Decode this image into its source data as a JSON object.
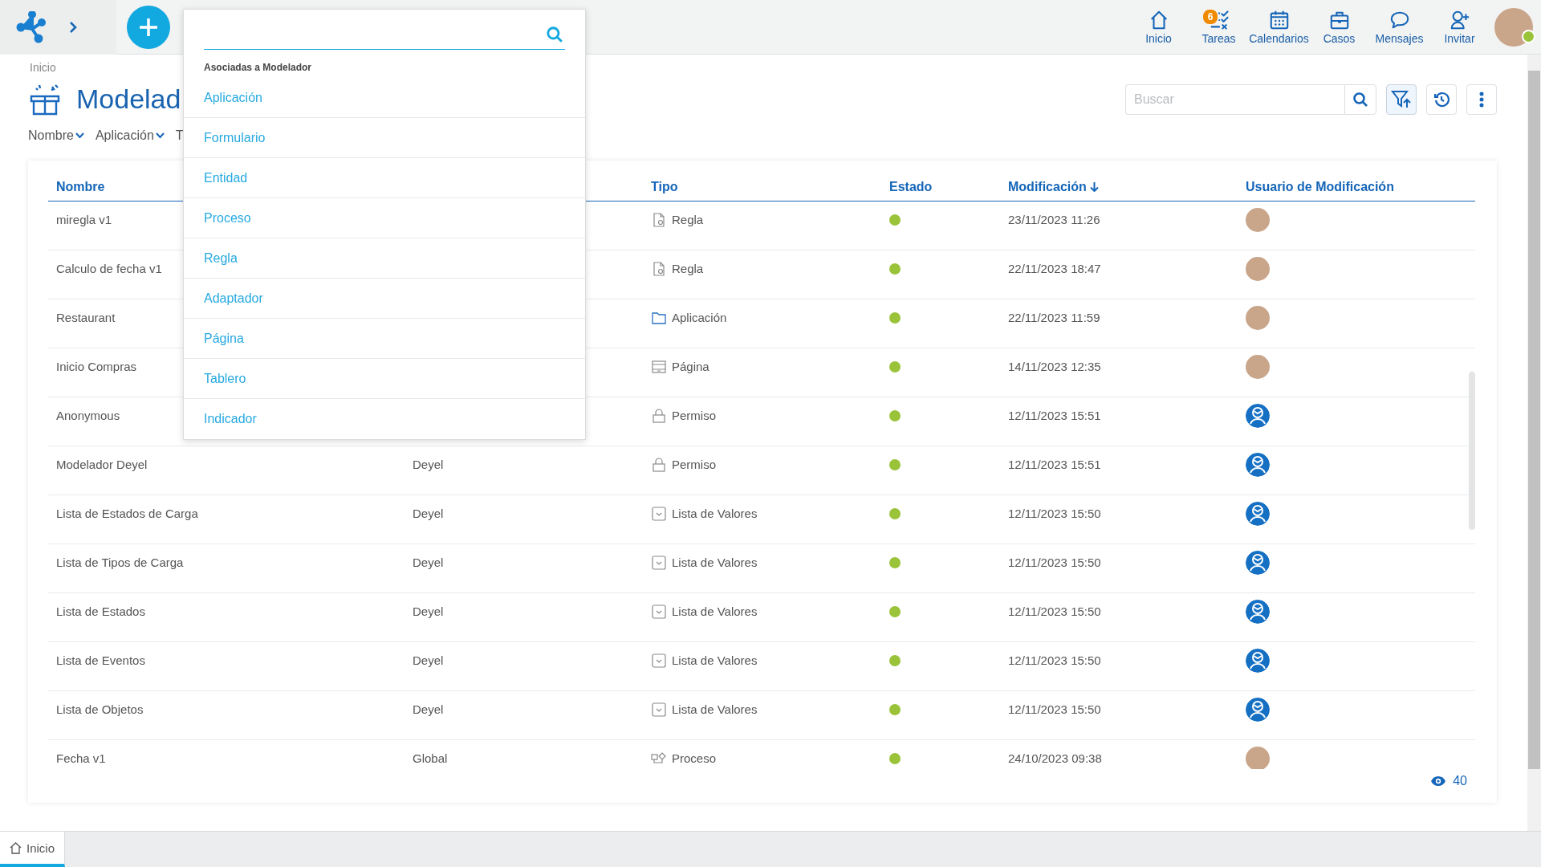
{
  "header": {
    "nav": [
      {
        "label": "Inicio",
        "kind": "home"
      },
      {
        "label": "Tareas",
        "kind": "tasks",
        "badge": "6"
      },
      {
        "label": "Calendarios",
        "kind": "calendar"
      },
      {
        "label": "Casos",
        "kind": "cases"
      },
      {
        "label": "Mensajes",
        "kind": "messages"
      },
      {
        "label": "Invitar",
        "kind": "invite"
      }
    ],
    "user": {
      "online": true
    }
  },
  "dropdown": {
    "section": "Asociadas a Modelador",
    "items": [
      {
        "label": "Aplicación",
        "selected": false
      },
      {
        "label": "Formulario",
        "selected": false
      },
      {
        "label": "Entidad",
        "selected": false
      },
      {
        "label": "Proceso",
        "selected": false
      },
      {
        "label": "Regla",
        "selected": false
      },
      {
        "label": "Adaptador",
        "selected": false
      },
      {
        "label": "Página",
        "selected": false
      },
      {
        "label": "Tablero",
        "selected": false
      },
      {
        "label": "Indicador",
        "selected": false
      }
    ]
  },
  "breadcrumb": "Inicio",
  "title": "Modelad",
  "filters": [
    {
      "label": "Nombre",
      "caret": true
    },
    {
      "label": "Aplicación",
      "caret": true
    },
    {
      "label": "T",
      "caret": false
    }
  ],
  "toolbar": {
    "search_placeholder": "Buscar",
    "filter_active": true
  },
  "table": {
    "columns": [
      {
        "label": "Nombre"
      },
      {
        "label": "Tipo"
      },
      {
        "label": "Estado"
      },
      {
        "label": "Modificación",
        "sorted": true
      },
      {
        "label": "Usuario de Modificación"
      }
    ],
    "rows": [
      {
        "name": "miregla v1",
        "type": "Regla",
        "kind": "rule",
        "color": "#9ac33a",
        "modified": "23/11/2023 11:26",
        "user": {
          "kind": "photo"
        }
      },
      {
        "name": "Calculo de fecha v1",
        "type": "Regla",
        "kind": "rule",
        "color": "#9ac33a",
        "modified": "22/11/2023 18:47",
        "user": {
          "kind": "photo"
        }
      },
      {
        "name": "Restaurant",
        "type": "Aplicación",
        "kind": "app",
        "color": "#9ac33a",
        "modified": "22/11/2023 11:59",
        "user": {
          "kind": "photo"
        }
      },
      {
        "name": "Inicio Compras",
        "type": "Página",
        "kind": "page",
        "color": "#9ac33a",
        "modified": "14/11/2023 12:35",
        "user": {
          "kind": "photo"
        }
      },
      {
        "name": "Anonymous",
        "type": "Permiso",
        "kind": "permission",
        "color": "#9ac33a",
        "modified": "12/11/2023 15:51",
        "user": {
          "kind": "system"
        }
      },
      {
        "name": "Modelador Deyel",
        "column_2": "Deyel",
        "type": "Permiso",
        "kind": "permission",
        "color": "#9ac33a",
        "modified": "12/11/2023 15:51",
        "user": {
          "kind": "system"
        }
      },
      {
        "name": "Lista de Estados de Carga",
        "column_2": "Deyel",
        "type": "Lista de Valores",
        "kind": "list",
        "color": "#9ac33a",
        "modified": "12/11/2023 15:50",
        "user": {
          "kind": "system"
        }
      },
      {
        "name": "Lista de Tipos de Carga",
        "column_2": "Deyel",
        "type": "Lista de Valores",
        "kind": "list",
        "color": "#9ac33a",
        "modified": "12/11/2023 15:50",
        "user": {
          "kind": "system"
        }
      },
      {
        "name": "Lista de Estados",
        "column_2": "Deyel",
        "type": "Lista de Valores",
        "kind": "list",
        "color": "#9ac33a",
        "modified": "12/11/2023 15:50",
        "user": {
          "kind": "system"
        }
      },
      {
        "name": "Lista de Eventos",
        "column_2": "Deyel",
        "type": "Lista de Valores",
        "kind": "list",
        "color": "#9ac33a",
        "modified": "12/11/2023 15:50",
        "user": {
          "kind": "system"
        }
      },
      {
        "name": "Lista de Objetos",
        "column_2": "Deyel",
        "type": "Lista de Valores",
        "kind": "list",
        "color": "#9ac33a",
        "modified": "12/11/2023 15:50",
        "user": {
          "kind": "system"
        }
      },
      {
        "name": "Fecha v1",
        "column_2": "Global",
        "type": "Proceso",
        "kind": "process",
        "color": "#9ac33a",
        "modified": "24/10/2023 09:38",
        "user": {
          "kind": "photo"
        }
      }
    ],
    "count": "40"
  },
  "bottom_tabs": [
    {
      "label": "Inicio",
      "selected": true
    }
  ]
}
